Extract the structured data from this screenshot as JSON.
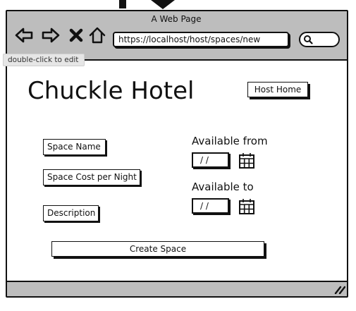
{
  "window": {
    "title": "A Web Page"
  },
  "browser": {
    "url": "https://localhost/host/spaces/new",
    "tooltip": "double-click to edit"
  },
  "page": {
    "title": "Chuckle Hotel",
    "host_home_label": "Host Home",
    "space_name_label": "Space Name",
    "space_cost_label": "Space Cost per Night",
    "description_label": "Description",
    "available_from_label": "Available from",
    "available_to_label": "Available to",
    "available_from_value": "/ /",
    "available_to_value": "/ /",
    "create_label": "Create Space"
  }
}
